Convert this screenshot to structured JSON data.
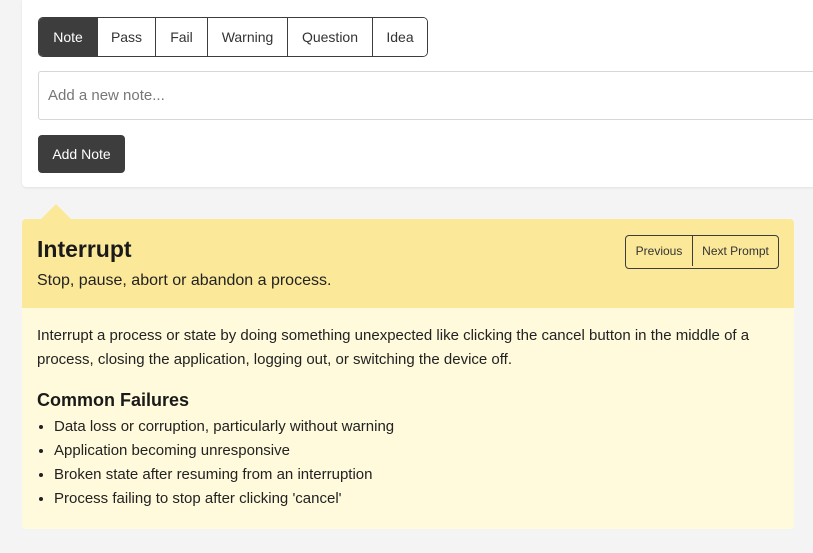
{
  "note_types": [
    {
      "label": "Note",
      "active": true
    },
    {
      "label": "Pass",
      "active": false
    },
    {
      "label": "Fail",
      "active": false
    },
    {
      "label": "Warning",
      "active": false
    },
    {
      "label": "Question",
      "active": false
    },
    {
      "label": "Idea",
      "active": false
    }
  ],
  "note_input": {
    "placeholder": "Add a new note...",
    "value": ""
  },
  "add_note_label": "Add Note",
  "prompt": {
    "title": "Interrupt",
    "subtitle": "Stop, pause, abort or abandon a process.",
    "previous_label": "Previous",
    "next_label": "Next Prompt",
    "description": "Interrupt a process or state by doing something unexpected like clicking the cancel button in the middle of a process, closing the application, logging out, or switching the device off.",
    "failures_heading": "Common Failures",
    "failures": [
      "Data loss or corruption, particularly without warning",
      "Application becoming unresponsive",
      "Broken state after resuming from an interruption",
      "Process failing to stop after clicking 'cancel'"
    ]
  },
  "colors": {
    "dark_button": "#3d3d3d",
    "prompt_header_bg": "#fbe999",
    "prompt_body_bg": "#fffadb"
  }
}
